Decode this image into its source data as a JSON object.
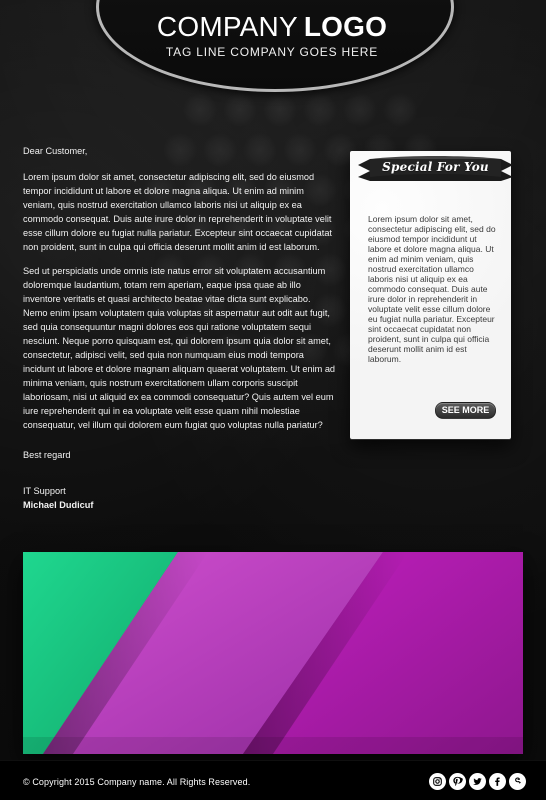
{
  "header": {
    "brand_company": "COMPANY",
    "brand_logo": "LOGO",
    "tagline": "TAG LINE COMPANY GOES HERE"
  },
  "letter": {
    "greeting": "Dear Customer,",
    "paragraph1": "Lorem ipsum dolor sit amet, consectetur adipiscing elit, sed do eiusmod tempor incididunt ut labore et dolore magna aliqua. Ut enim ad minim veniam, quis nostrud exercitation ullamco laboris nisi ut aliquip ex ea commodo consequat. Duis aute irure dolor in reprehenderit in voluptate velit esse cillum dolore eu fugiat nulla pariatur. Excepteur sint occaecat cupidatat non proident, sunt in culpa qui officia deserunt mollit anim id est laborum.",
    "paragraph2": "Sed ut perspiciatis unde omnis iste natus error sit voluptatem accusantium doloremque laudantium, totam rem aperiam, eaque ipsa quae ab illo inventore veritatis et quasi architecto beatae vitae dicta sunt explicabo. Nemo enim ipsam voluptatem quia voluptas sit aspernatur aut odit aut fugit, sed quia consequuntur magni dolores eos qui ratione voluptatem sequi nesciunt. Neque porro quisquam est, qui dolorem ipsum quia dolor sit amet, consectetur, adipisci velit, sed quia non numquam eius modi tempora incidunt ut labore et dolore magnam aliquam quaerat voluptatem. Ut enim ad minima veniam, quis nostrum exercitationem ullam corporis suscipit laboriosam, nisi ut aliquid ex ea commodi consequatur? Quis autem vel eum iure reprehenderit qui in ea voluptate velit esse quam nihil molestiae consequatur, vel illum qui dolorem eum fugiat quo voluptas nulla pariatur?",
    "sign_off": "Best regard",
    "sig_title": "IT Support",
    "sig_name": "Michael Dudicuf"
  },
  "special": {
    "title": "Special For You",
    "body": "Lorem ipsum dolor sit amet, consectetur adipiscing elit, sed do eiusmod tempor incididunt ut labore et dolore magna aliqua. Ut enim ad minim veniam, quis nostrud exercitation ullamco laboris nisi ut aliquip ex ea commodo consequat. Duis aute irure dolor in reprehenderit in voluptate velit esse cillum dolore eu fugiat nulla pariatur. Excepteur sint occaecat cupidatat non proident, sunt in culpa qui officia deserunt mollit anim id est laborum.",
    "button_label": "SEE MORE"
  },
  "footer": {
    "copyright": "© Copyright 2015 Company name. All Rights Reserved."
  },
  "social": {
    "icons": [
      "instagram-icon",
      "pinterest-icon",
      "twitter-icon",
      "facebook-icon",
      "google-plus-icon"
    ]
  },
  "colors": {
    "background": "#0d0d0d",
    "card": "#f0f0f0",
    "ribbon": "#1b1b1b",
    "button": "#3a3a3a",
    "hero_green": "#22c07c",
    "hero_purple": "#7b2e86",
    "hero_magenta": "#c022b8",
    "text": "#f2f2f2"
  }
}
